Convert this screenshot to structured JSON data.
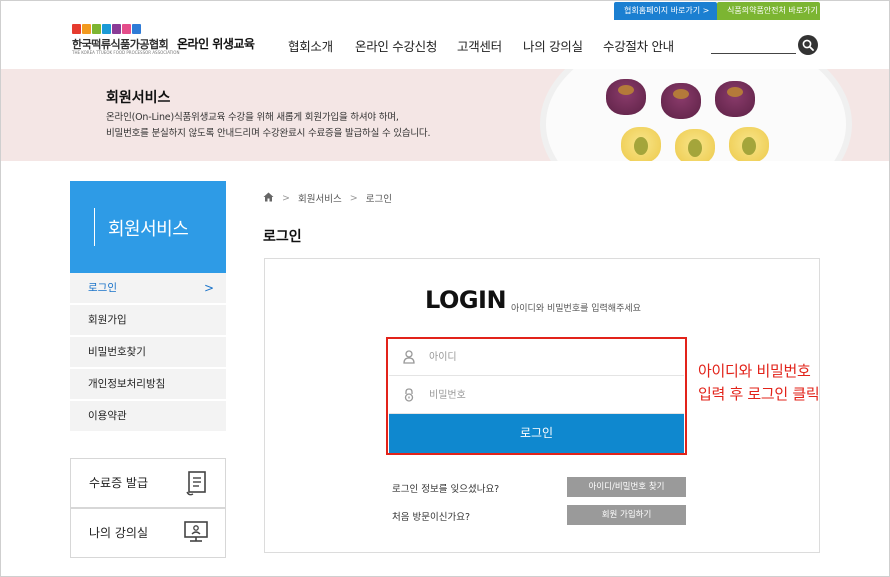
{
  "top_links": {
    "association_home": "협회홈페이지 바로가기 >",
    "mfds_home": "식품의약품안전처 바로가기 >"
  },
  "logo": {
    "org_name": "한국떡류식품가공협회",
    "program_name": "온라인 위생교육",
    "english_name": "THE KOREA TTUEOK FOOD PROCESSOR ASSOCIATION",
    "mark_colors": [
      "#e63b2e",
      "#f29a1f",
      "#7cb532",
      "#1b9ad6",
      "#8a3b96",
      "#e44d8a",
      "#2e7bd6"
    ]
  },
  "nav": {
    "items": [
      "협회소개",
      "온라인 수강신청",
      "고객센터",
      "나의 강의실",
      "수강절차 안내"
    ]
  },
  "search": {
    "icon": "search-icon"
  },
  "banner": {
    "title": "회원서비스",
    "desc_line1": "온라인(On-Line)식품위생교육 수강을 위해 새롭게 회원가입을 하셔야 하며,",
    "desc_line2": "비밀번호를 분실하지 않도록 안내드리며 수강완료시 수료증을 발급하실 수 있습니다."
  },
  "sidebar": {
    "title": "회원서비스",
    "items": [
      {
        "label": "로그인",
        "arrow": ">"
      },
      {
        "label": "회원가입"
      },
      {
        "label": "비밀번호찾기"
      },
      {
        "label": "개인정보처리방침"
      },
      {
        "label": "이용약관"
      }
    ],
    "quick": [
      {
        "label": "수료증 발급",
        "icon": "certificate-icon"
      },
      {
        "label": "나의 강의실",
        "icon": "monitor-icon"
      }
    ]
  },
  "breadcrumb": {
    "home_icon": "home-icon",
    "items": [
      "회원서비스",
      "로그인"
    ],
    "separator": ">"
  },
  "page_title": "로그인",
  "login": {
    "heading": "LOGIN",
    "subheading": "아이디와 비밀번호를 입력해주세요",
    "id_placeholder": "아이디",
    "pw_placeholder": "비밀번호",
    "button": "로그인"
  },
  "callout": {
    "line1": "아이디와 비밀번호",
    "line2": "입력 후 로그인 클릭"
  },
  "help": {
    "forgot_q": "로그인 정보를 잊으셨나요?",
    "forgot_btn": "아이디/비밀번호 찾기",
    "first_q": "처음 방문이신가요?",
    "join_btn": "회원 가입하기"
  },
  "colors": {
    "primary": "#0f88cf",
    "sidebar_head": "#2e9be6",
    "annotation": "#e2231a",
    "green": "#7cb532"
  }
}
